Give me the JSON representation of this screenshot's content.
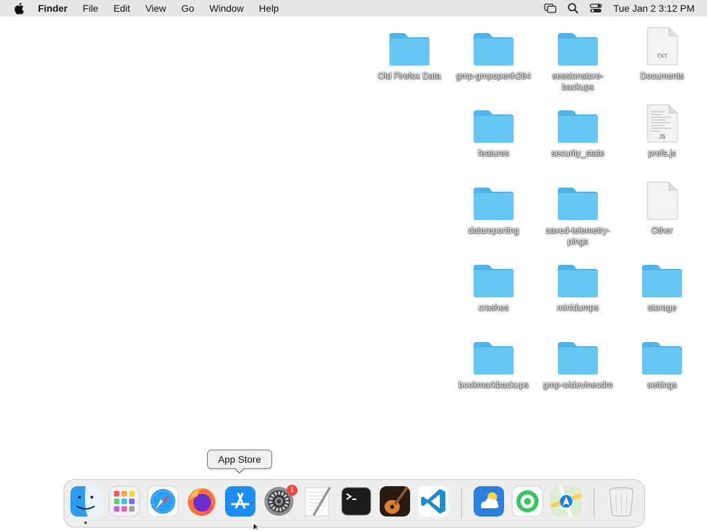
{
  "menubar": {
    "app_name": "Finder",
    "menus": [
      "File",
      "Edit",
      "View",
      "Go",
      "Window",
      "Help"
    ],
    "status_icons": [
      "screen-mirroring-icon",
      "spotlight-search-icon",
      "control-center-icon"
    ],
    "clock": "Tue Jan 2  3:12 PM"
  },
  "desktop": {
    "items": [
      {
        "label": "Old Firefox Data",
        "kind": "folder"
      },
      {
        "label": "gmp-gmpopenh264",
        "kind": "folder"
      },
      {
        "label": "sessionstore-backups",
        "kind": "folder"
      },
      {
        "label": "Documents",
        "kind": "txt-file",
        "badge": "TXT"
      },
      {
        "label": "features",
        "kind": "folder"
      },
      {
        "label": "security_state",
        "kind": "folder"
      },
      {
        "label": "prefs.js",
        "kind": "js-file",
        "badge": "JS"
      },
      {
        "label": "datareporting",
        "kind": "folder"
      },
      {
        "label": "saved-telemetry-pings",
        "kind": "folder"
      },
      {
        "label": "Other",
        "kind": "blank-file"
      },
      {
        "label": "crashes",
        "kind": "folder"
      },
      {
        "label": "minidumps",
        "kind": "folder"
      },
      {
        "label": "storage",
        "kind": "folder"
      },
      {
        "label": "bookmarkbackups",
        "kind": "folder"
      },
      {
        "label": "gmp-widevinecdm",
        "kind": "folder"
      },
      {
        "label": "settings",
        "kind": "folder"
      }
    ]
  },
  "dock": {
    "apps": [
      {
        "name": "Finder",
        "icon": "finder-icon",
        "running": true
      },
      {
        "name": "Launchpad",
        "icon": "launchpad-icon"
      },
      {
        "name": "Safari",
        "icon": "safari-icon"
      },
      {
        "name": "Firefox",
        "icon": "firefox-icon"
      },
      {
        "name": "App Store",
        "icon": "app-store-icon"
      },
      {
        "name": "System Settings",
        "icon": "system-settings-icon",
        "badge": "1"
      },
      {
        "name": "TextEdit",
        "icon": "textedit-icon"
      },
      {
        "name": "Terminal",
        "icon": "terminal-icon"
      },
      {
        "name": "GarageBand",
        "icon": "garageband-icon"
      },
      {
        "name": "Visual Studio Code",
        "icon": "vscode-icon"
      },
      {
        "name": "Weather",
        "icon": "weather-icon"
      },
      {
        "name": "Find My",
        "icon": "find-my-icon"
      },
      {
        "name": "Maps",
        "icon": "maps-icon"
      },
      {
        "name": "Trash",
        "icon": "trash-icon"
      }
    ],
    "tooltip": "App Store"
  },
  "colors": {
    "menubar_bg": "#e6e6e6",
    "folder_blue": "#5ec2f2",
    "badge_red": "#f0463d"
  }
}
